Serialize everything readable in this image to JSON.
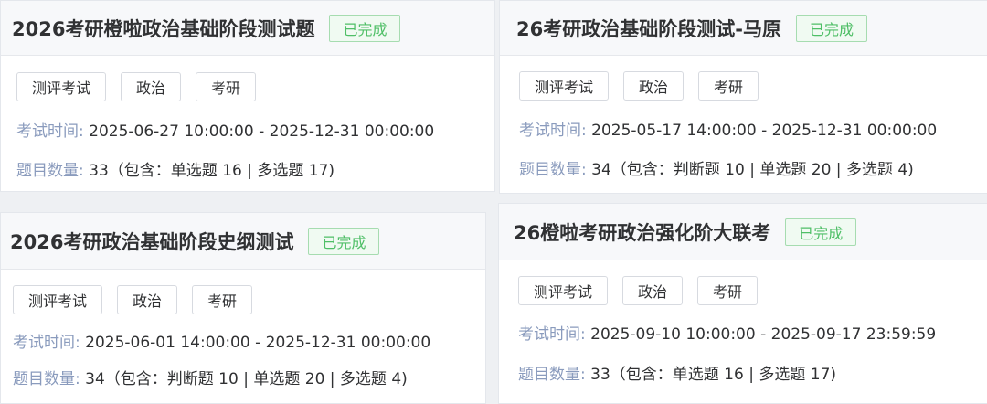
{
  "cards": [
    {
      "title": "2026考研橙啦政治基础阶段测试题",
      "status": "已完成",
      "tags": [
        "测评考试",
        "政治",
        "考研"
      ],
      "time_label": "考试时间:",
      "time_value": "2025-06-27 10:00:00 - 2025-12-31 00:00:00",
      "count_label": "题目数量:",
      "count_value": "33（包含：单选题 16 | 多选题 17)"
    },
    {
      "title": "26考研政治基础阶段测试-马原",
      "status": "已完成",
      "tags": [
        "测评考试",
        "政治",
        "考研"
      ],
      "time_label": "考试时间:",
      "time_value": "2025-05-17 14:00:00 - 2025-12-31 00:00:00",
      "count_label": "题目数量:",
      "count_value": "34（包含：判断题 10 | 单选题 20 | 多选题 4)"
    },
    {
      "title": "2026考研政治基础阶段史纲测试",
      "status": "已完成",
      "tags": [
        "测评考试",
        "政治",
        "考研"
      ],
      "time_label": "考试时间:",
      "time_value": "2025-06-01 14:00:00 - 2025-12-31 00:00:00",
      "count_label": "题目数量:",
      "count_value": "34（包含：判断题 10 | 单选题 20 | 多选题 4)"
    },
    {
      "title": "26橙啦考研政治强化阶大联考",
      "status": "已完成",
      "tags": [
        "测评考试",
        "政治",
        "考研"
      ],
      "time_label": "考试时间:",
      "time_value": "2025-09-10 10:00:00 - 2025-09-17 23:59:59",
      "count_label": "题目数量:",
      "count_value": "33（包含：单选题 16 | 多选题 17)"
    }
  ]
}
